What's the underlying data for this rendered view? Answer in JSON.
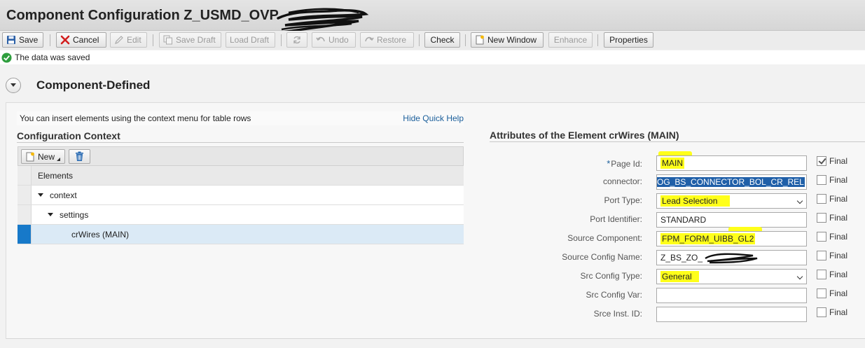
{
  "window": {
    "title": "Component Configuration Z_USMD_OVP"
  },
  "toolbar": {
    "save": "Save",
    "cancel": "Cancel",
    "edit": "Edit",
    "save_draft": "Save Draft",
    "load_draft": "Load Draft",
    "undo": "Undo",
    "restore": "Restore",
    "check": "Check",
    "new_window": "New Window",
    "enhance": "Enhance",
    "properties": "Properties"
  },
  "message": {
    "text": "The data was saved",
    "type": "success"
  },
  "section": {
    "title": "Component-Defined"
  },
  "quick_help": {
    "text": "You can insert elements using the context menu for table rows",
    "link": "Hide Quick Help"
  },
  "context": {
    "title": "Configuration Context",
    "new_button": "New",
    "column_header": "Elements",
    "rows": [
      {
        "label": "context",
        "level": 0,
        "expanded": true,
        "selected": false
      },
      {
        "label": "settings",
        "level": 1,
        "expanded": true,
        "selected": false
      },
      {
        "label": "crWires (MAIN)",
        "level": 2,
        "expanded": false,
        "selected": true
      }
    ]
  },
  "attributes": {
    "title": "Attributes of the Element crWires (MAIN)",
    "final_label": "Final",
    "fields": [
      {
        "label": "Page Id:",
        "value": "MAIN",
        "required": true,
        "final": true,
        "highlighted": true
      },
      {
        "label": "connector:",
        "value": "OG_BS_CONNECTOR_BOL_CR_REL",
        "final": false,
        "selected_text": true
      },
      {
        "label": "Port Type:",
        "value": "Lead Selection",
        "final": false,
        "dropdown": true,
        "highlighted": true
      },
      {
        "label": "Port Identifier:",
        "value": "STANDARD",
        "final": false
      },
      {
        "label": "Source Component:",
        "value": "FPM_FORM_UIBB_GL2",
        "final": false,
        "highlighted": true
      },
      {
        "label": "Source Config Name:",
        "value": "Z_BS_ZO_",
        "final": false,
        "redacted": true
      },
      {
        "label": "Src Config Type:",
        "value": "General",
        "final": false,
        "dropdown": true,
        "highlighted": true
      },
      {
        "label": "Src Config Var:",
        "value": "",
        "final": false
      },
      {
        "label": "Srce Inst. ID:",
        "value": "",
        "final": false
      }
    ]
  },
  "colors": {
    "selection_blue": "#1779c9",
    "highlight_yellow": "#ffff1a",
    "link_blue": "#1a5e9a",
    "success_green": "#2e9e3e"
  }
}
